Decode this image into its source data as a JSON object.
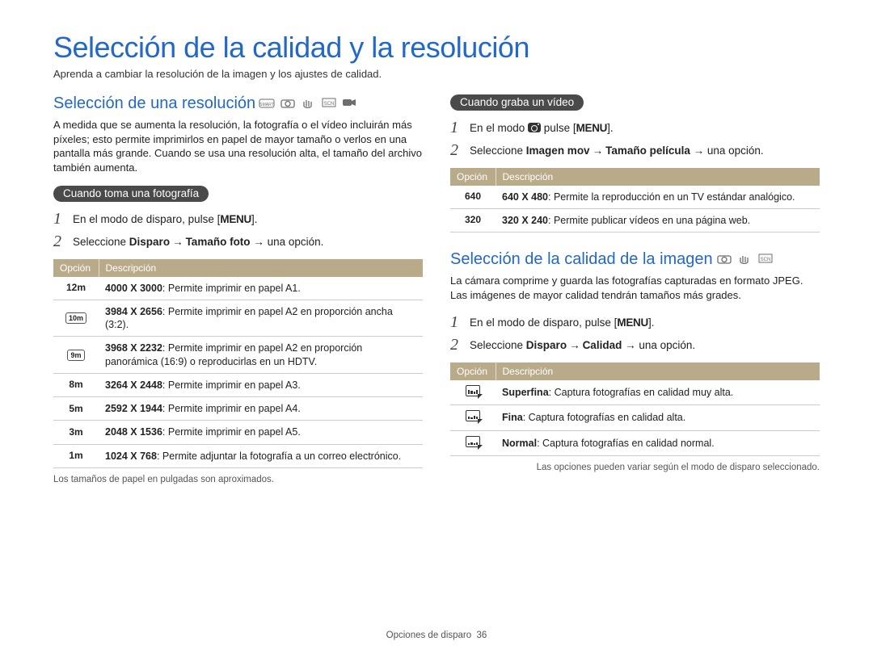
{
  "page": {
    "title": "Selección de la calidad y la resolución",
    "intro": "Aprenda a cambiar la resolución de la imagen y los ajustes de calidad.",
    "footer_section": "Opciones de disparo",
    "footer_page": "36"
  },
  "left": {
    "section_title": "Selección de una resolución",
    "paragraph": "A medida que se aumenta la resolución, la fotografía o el vídeo incluirán más píxeles; esto permite imprimirlos en papel de mayor tamaño o verlos en una pantalla más grande. Cuando se usa una resolución alta, el tamaño del archivo también aumenta.",
    "pill": "Cuando toma una fotografía",
    "step1_pre": "En el modo de disparo, pulse [",
    "step1_key": "MENU",
    "step1_post": "].",
    "step2_pre": "Seleccione ",
    "step2_b1": "Disparo",
    "step2_arrow": "→",
    "step2_b2": "Tamaño foto",
    "step2_post": " → una opción.",
    "th_option": "Opción",
    "th_desc": "Descripción",
    "rows": [
      {
        "label": "12m",
        "dim": "4000 X 3000",
        "desc": ": Permite imprimir en papel A1."
      },
      {
        "label": "10m",
        "boxed": true,
        "dim": "3984 X 2656",
        "desc": ": Permite imprimir en papel A2 en proporción ancha (3:2)."
      },
      {
        "label": "9m",
        "boxed": true,
        "dim": "3968 X 2232",
        "desc": ": Permite imprimir en papel A2 en proporción panorámica (16:9) o reproducirlas en un HDTV."
      },
      {
        "label": "8m",
        "dim": "3264 X 2448",
        "desc": ": Permite imprimir en papel A3."
      },
      {
        "label": "5m",
        "dim": "2592 X 1944",
        "desc": ": Permite imprimir en papel A4."
      },
      {
        "label": "3m",
        "dim": "2048 X 1536",
        "desc": ": Permite imprimir en papel A5."
      },
      {
        "label": "1m",
        "dim": "1024 X 768",
        "desc": ": Permite adjuntar la fotografía a un correo electrónico."
      }
    ],
    "note": "Los tamaños de papel en pulgadas son aproximados."
  },
  "right_top": {
    "pill": "Cuando graba un vídeo",
    "step1_pre": "En el modo ",
    "step1_mid": " pulse [",
    "step1_key": "MENU",
    "step1_post": "].",
    "step2_pre": "Seleccione ",
    "step2_b1": "Imagen mov",
    "step2_arrow": "→",
    "step2_b2": "Tamaño película",
    "step2_post": " → una opción.",
    "th_option": "Opción",
    "th_desc": "Descripción",
    "rows": [
      {
        "label": "640",
        "dim": "640 X 480",
        "desc": ": Permite la reproducción en un TV estándar analógico."
      },
      {
        "label": "320",
        "dim": "320 X 240",
        "desc": ": Permite publicar vídeos en una página web."
      }
    ]
  },
  "right_bottom": {
    "section_title": "Selección de la calidad de la imagen",
    "paragraph": "La cámara comprime y guarda las fotografías capturadas en formato JPEG. Las imágenes de mayor calidad tendrán tamaños más grades.",
    "step1_pre": "En el modo de disparo, pulse [",
    "step1_key": "MENU",
    "step1_post": "].",
    "step2_pre": "Seleccione ",
    "step2_b1": "Disparo",
    "step2_arrow": "→",
    "step2_b2": "Calidad",
    "step2_post": " → una opción.",
    "th_option": "Opción",
    "th_desc": "Descripción",
    "rows": [
      {
        "label": "SF",
        "name": "Superfina",
        "desc": ": Captura fotografías en calidad muy alta."
      },
      {
        "label": "F",
        "name": "Fina",
        "desc": ": Captura fotografías en calidad alta."
      },
      {
        "label": "N",
        "name": "Normal",
        "desc": ": Captura fotografías en calidad normal."
      }
    ],
    "note": "Las opciones pueden variar según el modo de disparo seleccionado."
  }
}
